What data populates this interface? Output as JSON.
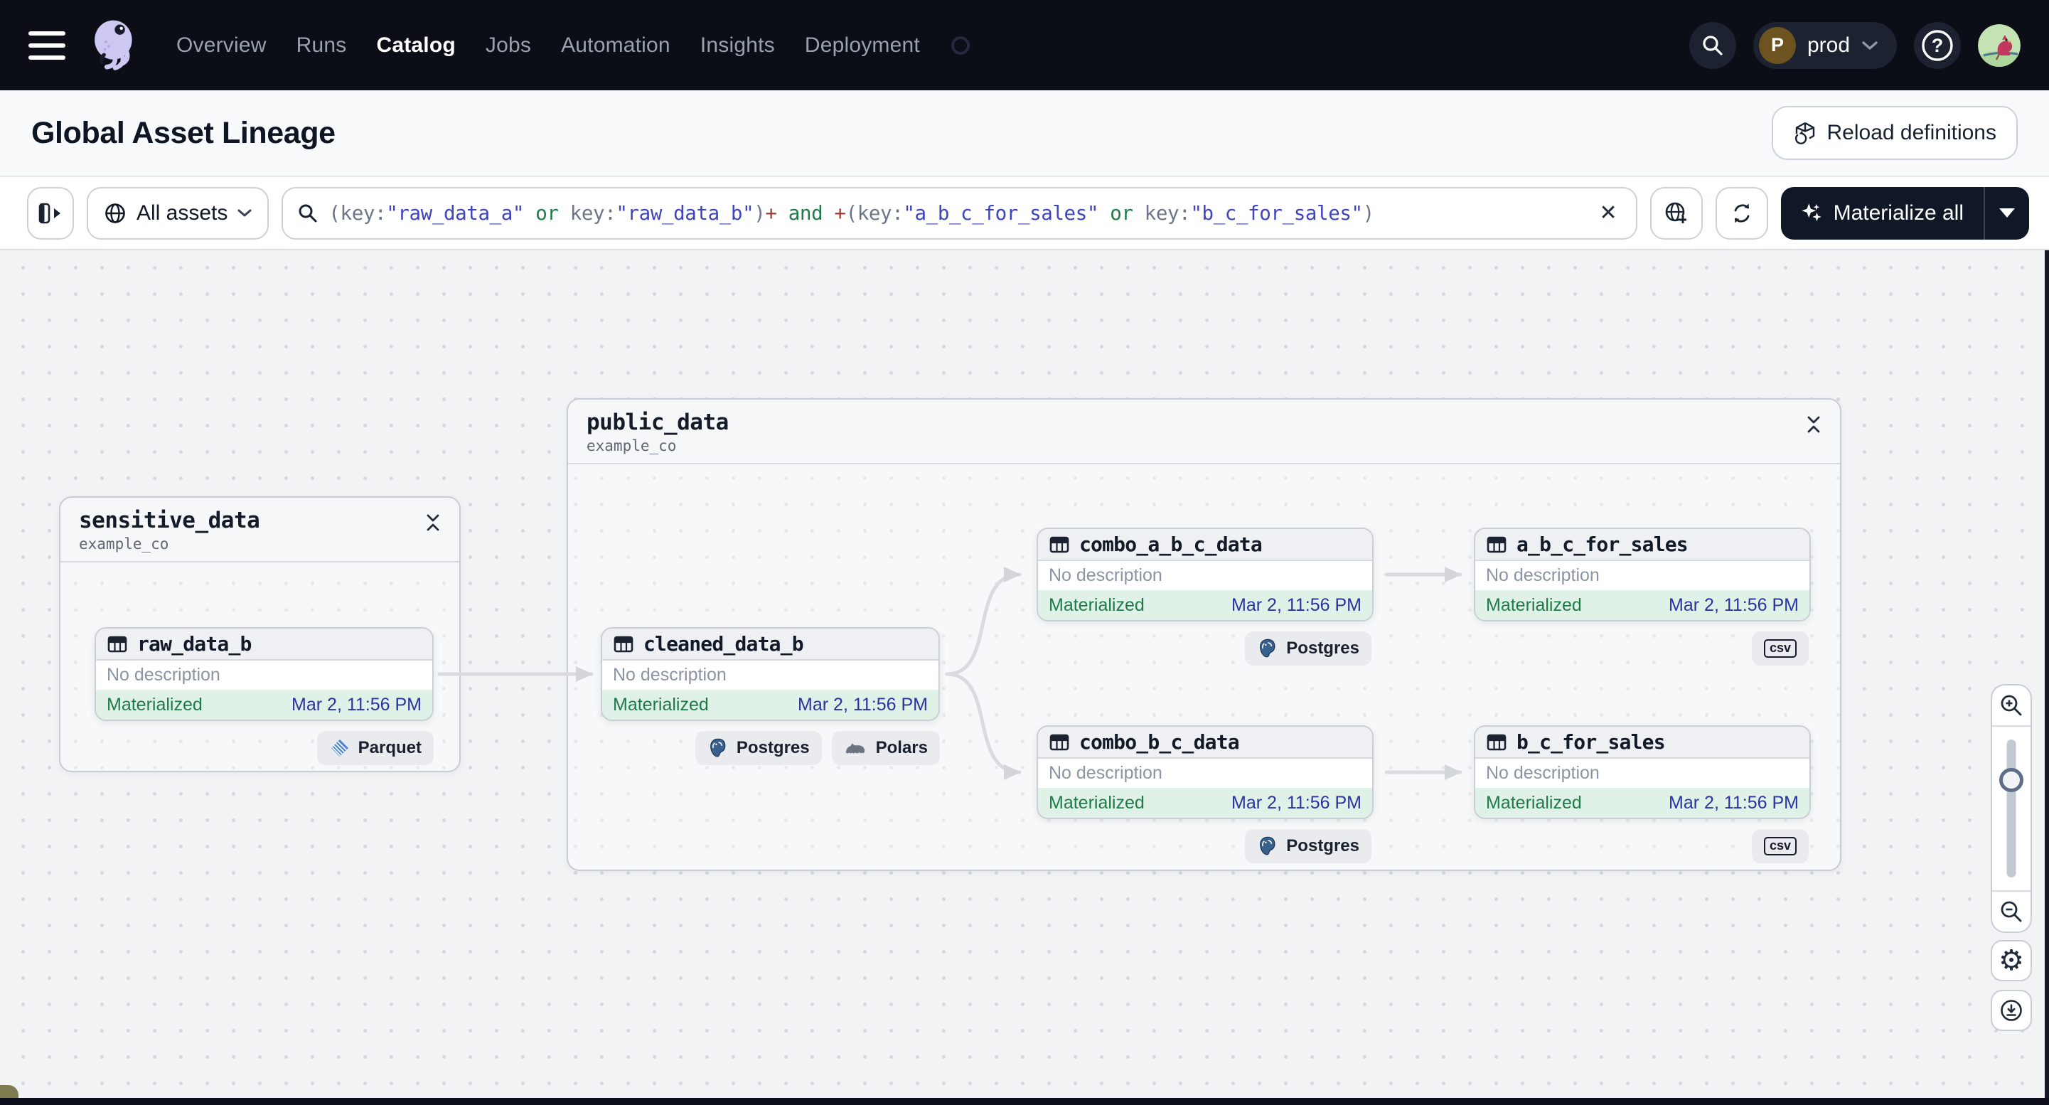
{
  "nav": {
    "items": [
      {
        "label": "Overview",
        "active": false
      },
      {
        "label": "Runs",
        "active": false
      },
      {
        "label": "Catalog",
        "active": true
      },
      {
        "label": "Jobs",
        "active": false
      },
      {
        "label": "Automation",
        "active": false
      },
      {
        "label": "Insights",
        "active": false
      },
      {
        "label": "Deployment",
        "active": false
      }
    ],
    "workspace": {
      "initial": "P",
      "name": "prod"
    }
  },
  "header": {
    "title": "Global Asset Lineage",
    "reload_label": "Reload definitions"
  },
  "toolbar": {
    "scope": {
      "label": "All assets"
    },
    "materialize": {
      "label": "Materialize all"
    },
    "search": {
      "tokens": [
        {
          "text": "(key:",
          "kind": "punct"
        },
        {
          "text": "\"raw_data_a\"",
          "kind": "value"
        },
        {
          "text": " or ",
          "kind": "op"
        },
        {
          "text": "key:",
          "kind": "punct"
        },
        {
          "text": "\"raw_data_b\"",
          "kind": "value"
        },
        {
          "text": ")",
          "kind": "punct"
        },
        {
          "text": "+",
          "kind": "plus"
        },
        {
          "text": " and ",
          "kind": "op"
        },
        {
          "text": "+",
          "kind": "plus"
        },
        {
          "text": "(key:",
          "kind": "punct"
        },
        {
          "text": "\"a_b_c_for_sales\"",
          "kind": "value"
        },
        {
          "text": " or ",
          "kind": "op"
        },
        {
          "text": "key:",
          "kind": "punct"
        },
        {
          "text": "\"b_c_for_sales\"",
          "kind": "value"
        },
        {
          "text": ")",
          "kind": "punct"
        }
      ]
    }
  },
  "graph": {
    "groups": [
      {
        "name": "sensitive_data",
        "location": "example_co"
      },
      {
        "name": "public_data",
        "location": "example_co"
      }
    ],
    "assets": [
      {
        "name": "raw_data_b",
        "description": "No description",
        "status": "Materialized",
        "materialized_at": "Mar 2, 11:56 PM",
        "badges": [
          "Parquet"
        ]
      },
      {
        "name": "cleaned_data_b",
        "description": "No description",
        "status": "Materialized",
        "materialized_at": "Mar 2, 11:56 PM",
        "badges": [
          "Postgres",
          "Polars"
        ]
      },
      {
        "name": "combo_a_b_c_data",
        "description": "No description",
        "status": "Materialized",
        "materialized_at": "Mar 2, 11:56 PM",
        "badges": [
          "Postgres"
        ]
      },
      {
        "name": "a_b_c_for_sales",
        "description": "No description",
        "status": "Materialized",
        "materialized_at": "Mar 2, 11:56 PM",
        "badges": [
          "csv"
        ]
      },
      {
        "name": "combo_b_c_data",
        "description": "No description",
        "status": "Materialized",
        "materialized_at": "Mar 2, 11:56 PM",
        "badges": [
          "Postgres"
        ]
      },
      {
        "name": "b_c_for_sales",
        "description": "No description",
        "status": "Materialized",
        "materialized_at": "Mar 2, 11:56 PM",
        "badges": [
          "csv"
        ]
      }
    ]
  },
  "colors": {
    "nav_bg": "#0b0d17",
    "status_green": "#1e7b49",
    "status_bg": "#e0f1e7",
    "timestamp_indigo": "#2a34a0",
    "query_value": "#3d44bd",
    "query_operator": "#217a4b",
    "query_plus": "#9d3b31",
    "edge_gray": "#d8dbdf"
  }
}
